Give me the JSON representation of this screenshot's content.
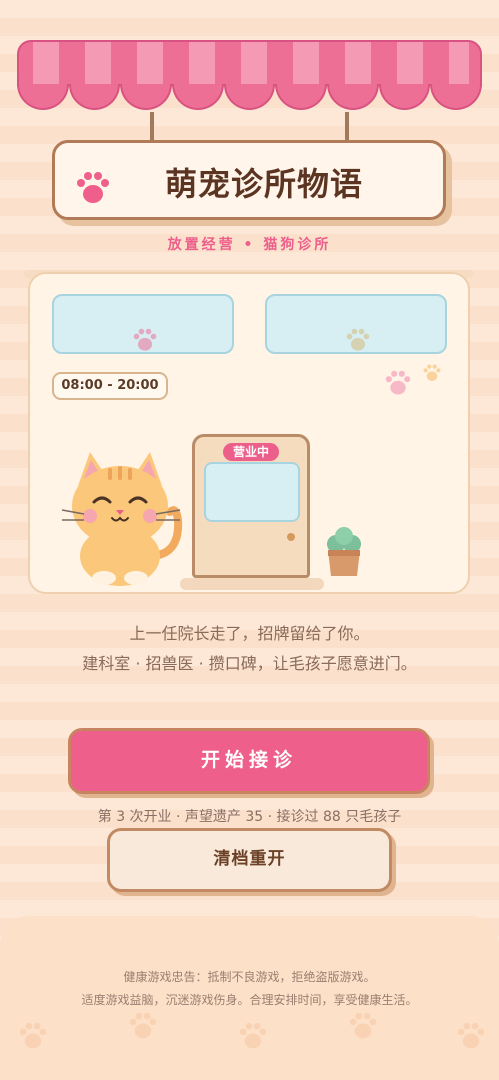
{
  "sign": {
    "title": "萌宠诊所物语",
    "paw_icon": "paw-icon"
  },
  "subtitle": "放置经营 • 猫狗诊所",
  "clinic": {
    "hours": "08:00 - 20:00",
    "door_sign": "营业中",
    "mascot": "orange-cat",
    "plant": "potted-plant"
  },
  "story": {
    "line1": "上一任院长走了，招牌留给了你。",
    "line2": "建科室 · 招兽医 · 攒口碑，让毛孩子愿意进门。"
  },
  "actions": {
    "start_label": "开始接诊",
    "stats": "第 3 次开业 · 声望遗产 35 · 接诊过 88 只毛孩子",
    "reset_label": "清档重开"
  },
  "footer": {
    "line1": "健康游戏忠告：抵制不良游戏，拒绝盗版游戏。",
    "line2": "适度游戏益脑，沉迷游戏伤身。合理安排时间，享受健康生活。"
  },
  "colors": {
    "accent_pink": "#ee5f8b",
    "brown": "#5b3422",
    "background": "#fde7d6"
  }
}
